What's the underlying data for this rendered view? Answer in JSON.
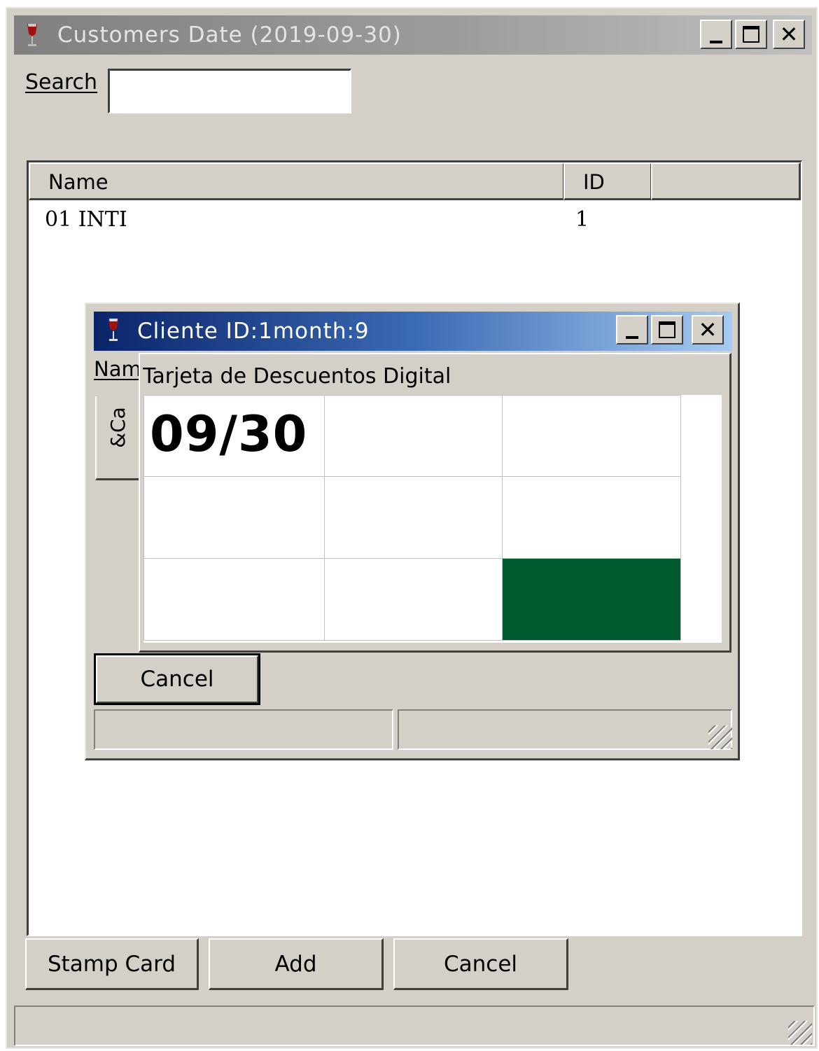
{
  "main_window": {
    "title": "Customers Date (2019-09-30)",
    "icon": "wine-glass-icon",
    "search": {
      "label": "Search",
      "value": ""
    },
    "columns": [
      {
        "label": "Name"
      },
      {
        "label": "ID"
      }
    ],
    "rows": [
      {
        "name": "01 INTI",
        "id": "1"
      }
    ],
    "buttons": {
      "stamp_card": "Stamp Card",
      "add": "Add",
      "cancel": "Cancel"
    }
  },
  "dialog": {
    "title": "Cliente ID:1month:9",
    "icon": "wine-glass-icon",
    "name_label": "Name",
    "vertical_tab_label": "&Ca",
    "card": {
      "caption": "Tarjeta de Descuentos Digital",
      "stamp_date": "09/30",
      "stamped_color": "#005a30"
    },
    "cancel_label": "Cancel"
  },
  "colors": {
    "window_bg": "#d4d0c8",
    "active_title_start": "#0a246a",
    "active_title_end": "#a6caf0",
    "inactive_title": "#808080"
  }
}
